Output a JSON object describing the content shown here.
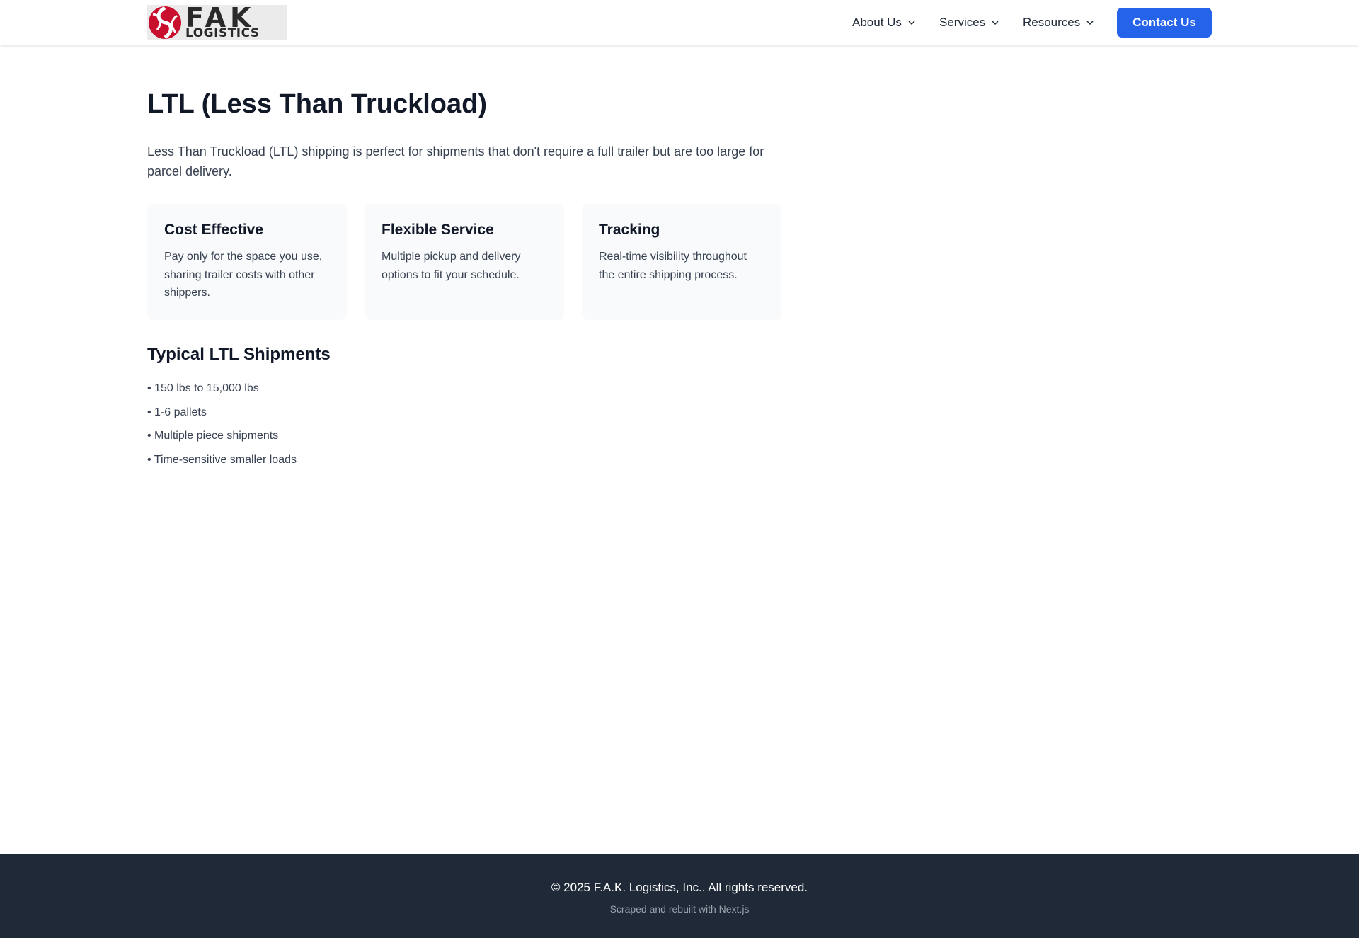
{
  "header": {
    "logo": {
      "main_text": "FAK",
      "sub_text": "LOGISTICS",
      "mark_color": "#c8102e"
    },
    "nav": [
      {
        "label": "About Us",
        "icon": "chevron-down-icon"
      },
      {
        "label": "Services",
        "icon": "chevron-down-icon"
      },
      {
        "label": "Resources",
        "icon": "chevron-down-icon"
      }
    ],
    "contact_button": "Contact Us"
  },
  "main": {
    "title": "LTL (Less Than Truckload)",
    "intro": "Less Than Truckload (LTL) shipping is perfect for shipments that don't require a full trailer but are too large for parcel delivery.",
    "features": [
      {
        "title": "Cost Effective",
        "text": "Pay only for the space you use, sharing trailer costs with other shippers."
      },
      {
        "title": "Flexible Service",
        "text": "Multiple pickup and delivery options to fit your schedule."
      },
      {
        "title": "Tracking",
        "text": "Real-time visibility throughout the entire shipping process."
      }
    ],
    "shipments_title": "Typical LTL Shipments",
    "shipments": [
      "• 150 lbs to 15,000 lbs",
      "• 1-6 pallets",
      "• Multiple piece shipments",
      "• Time-sensitive smaller loads"
    ]
  },
  "footer": {
    "copyright": "© 2025 F.A.K. Logistics, Inc.. All rights reserved.",
    "note": "Scraped and rebuilt with Next.js"
  },
  "colors": {
    "accent": "#2563eb",
    "footer_bg": "#1f2937",
    "card_bg": "#f9fafb"
  }
}
